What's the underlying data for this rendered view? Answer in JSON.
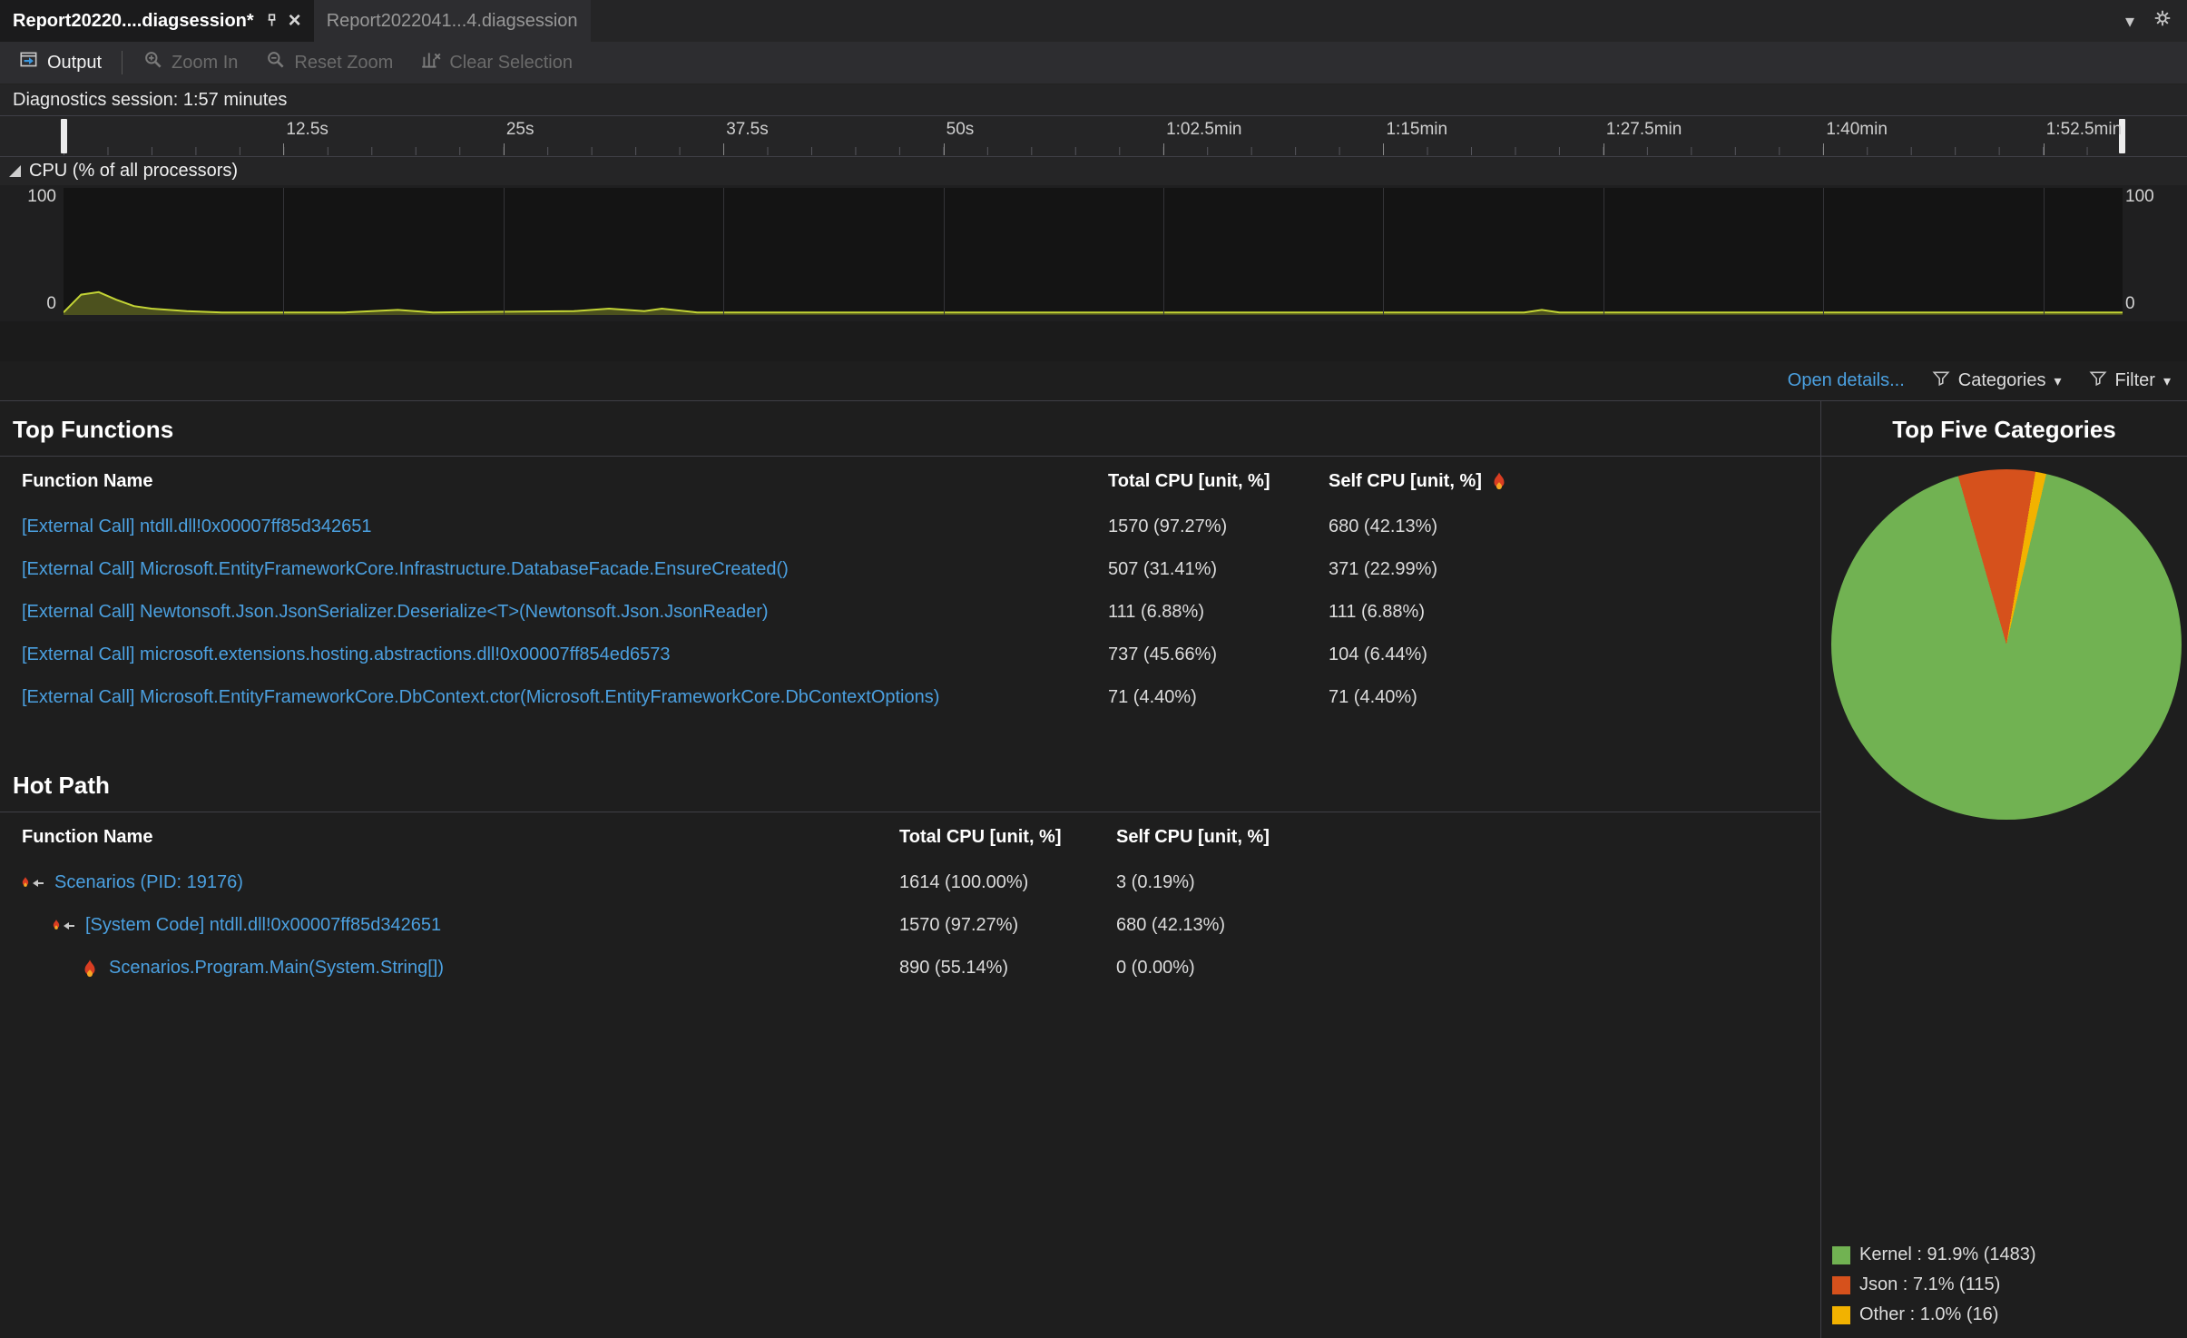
{
  "tabs": [
    {
      "label": "Report20220....diagsession*",
      "state": "active",
      "pinned": true
    },
    {
      "label": "Report2022041...4.diagsession",
      "state": "inactive"
    }
  ],
  "toolbar": {
    "output": "Output",
    "zoom_in": "Zoom In",
    "reset_zoom": "Reset Zoom",
    "clear_selection": "Clear Selection"
  },
  "session_label": "Diagnostics session: 1:57 minutes",
  "timeline": {
    "t_max": 117,
    "ticks": [
      {
        "t": 12.5,
        "label": "12.5s"
      },
      {
        "t": 25,
        "label": "25s"
      },
      {
        "t": 37.5,
        "label": "37.5s"
      },
      {
        "t": 50,
        "label": "50s"
      },
      {
        "t": 62.5,
        "label": "1:02.5min"
      },
      {
        "t": 75,
        "label": "1:15min"
      },
      {
        "t": 87.5,
        "label": "1:27.5min"
      },
      {
        "t": 100,
        "label": "1:40min"
      },
      {
        "t": 112.5,
        "label": "1:52.5min"
      }
    ]
  },
  "cpu_section": {
    "title": "CPU (% of all processors)",
    "y_max": "100",
    "y_min": "0"
  },
  "details_bar": {
    "open_details": "Open details...",
    "categories": "Categories",
    "filter": "Filter"
  },
  "top_functions": {
    "title": "Top Functions",
    "columns": [
      "Function Name",
      "Total CPU [unit, %]",
      "Self CPU [unit, %]"
    ],
    "rows": [
      {
        "name": "[External Call] ntdll.dll!0x00007ff85d342651",
        "total": "1570 (97.27%)",
        "self": "680 (42.13%)"
      },
      {
        "name": "[External Call] Microsoft.EntityFrameworkCore.Infrastructure.DatabaseFacade.EnsureCreated()",
        "total": "507 (31.41%)",
        "self": "371 (22.99%)"
      },
      {
        "name": "[External Call] Newtonsoft.Json.JsonSerializer.Deserialize<T>(Newtonsoft.Json.JsonReader)",
        "total": "111 (6.88%)",
        "self": "111 (6.88%)"
      },
      {
        "name": "[External Call] microsoft.extensions.hosting.abstractions.dll!0x00007ff854ed6573",
        "total": "737 (45.66%)",
        "self": "104 (6.44%)"
      },
      {
        "name": "[External Call] Microsoft.EntityFrameworkCore.DbContext.ctor(Microsoft.EntityFrameworkCore.DbContextOptions)",
        "total": "71 (4.40%)",
        "self": "71 (4.40%)"
      }
    ]
  },
  "hot_path": {
    "title": "Hot Path",
    "columns": [
      "Function Name",
      "Total CPU [unit, %]",
      "Self CPU [unit, %]"
    ],
    "rows": [
      {
        "name": "Scenarios (PID: 19176)",
        "total": "1614 (100.00%)",
        "self": "3 (0.19%)",
        "indent": 0,
        "icon": "hot-path-flame-arrow"
      },
      {
        "name": "[System Code] ntdll.dll!0x00007ff85d342651",
        "total": "1570 (97.27%)",
        "self": "680 (42.13%)",
        "indent": 1,
        "icon": "hot-path-flame-arrow"
      },
      {
        "name": "Scenarios.Program.Main(System.String[])",
        "total": "890 (55.14%)",
        "self": "0 (0.00%)",
        "indent": 2,
        "icon": "flame"
      }
    ]
  },
  "top_categories": {
    "title": "Top Five Categories"
  },
  "chart_data": [
    {
      "type": "area",
      "title": "CPU (% of all processors)",
      "ylabel": "% of all processors",
      "ylim": [
        0,
        100
      ],
      "x_unit": "seconds",
      "x_range": [
        0,
        117
      ],
      "grid": "vertical",
      "series_color": "#c3d435",
      "points": [
        [
          0,
          2
        ],
        [
          1,
          16
        ],
        [
          2,
          18
        ],
        [
          3,
          12
        ],
        [
          4,
          7
        ],
        [
          5,
          5
        ],
        [
          7,
          3
        ],
        [
          9,
          2
        ],
        [
          16,
          2
        ],
        [
          19,
          4
        ],
        [
          21,
          2
        ],
        [
          29,
          3
        ],
        [
          31,
          5
        ],
        [
          33,
          3
        ],
        [
          34,
          5
        ],
        [
          36,
          2
        ],
        [
          50,
          2
        ],
        [
          70,
          2
        ],
        [
          83,
          2
        ],
        [
          84,
          4
        ],
        [
          85,
          2
        ],
        [
          100,
          2
        ],
        [
          117,
          2
        ]
      ]
    },
    {
      "type": "pie",
      "title": "Top Five Categories",
      "start_angle_deg": -16,
      "legend_position": "bottom-left",
      "slices": [
        {
          "label": "Json",
          "value": 7.1,
          "count": 115,
          "color": "#d6511c"
        },
        {
          "label": "Other",
          "value": 1.0,
          "count": 16,
          "color": "#f2b200"
        },
        {
          "label": "Kernel",
          "value": 91.9,
          "count": 1483,
          "color": "#71b252"
        }
      ],
      "legend": [
        {
          "text": "Kernel : 91.9% (1483)",
          "color": "#71b252"
        },
        {
          "text": "Json : 7.1% (115)",
          "color": "#d6511c"
        },
        {
          "text": "Other : 1.0% (16)",
          "color": "#f2b200"
        }
      ]
    }
  ]
}
